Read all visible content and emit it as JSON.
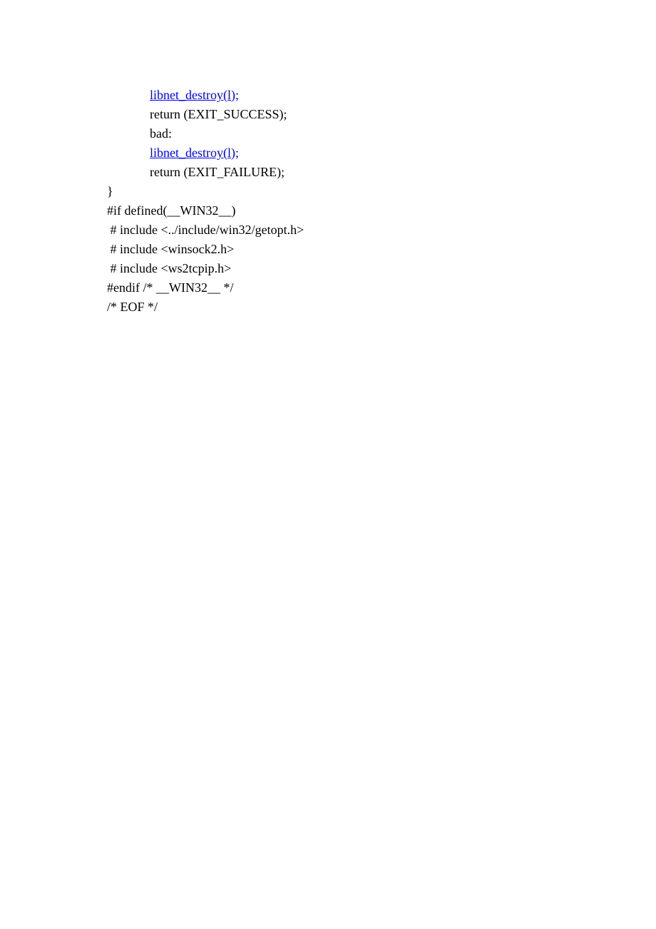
{
  "lines": [
    {
      "indent": true,
      "segments": [
        {
          "type": "link",
          "text": "libnet_destroy(l);"
        }
      ]
    },
    {
      "indent": true,
      "segments": [
        {
          "type": "text",
          "text": "return (EXIT_SUCCESS);"
        }
      ]
    },
    {
      "indent": true,
      "segments": [
        {
          "type": "text",
          "text": "bad:"
        }
      ]
    },
    {
      "indent": true,
      "segments": [
        {
          "type": "link",
          "text": "libnet_destroy(l);"
        }
      ]
    },
    {
      "indent": true,
      "segments": [
        {
          "type": "text",
          "text": "return (EXIT_FAILURE);"
        }
      ]
    },
    {
      "indent": false,
      "segments": [
        {
          "type": "text",
          "text": "}"
        }
      ]
    },
    {
      "indent": false,
      "segments": [
        {
          "type": "text",
          "text": "#if defined(__WIN32__)"
        }
      ]
    },
    {
      "indent": false,
      "segments": [
        {
          "type": "text",
          "text": " # include <../include/win32/getopt.h>"
        }
      ]
    },
    {
      "indent": false,
      "segments": [
        {
          "type": "text",
          "text": " # include <winsock2.h>"
        }
      ]
    },
    {
      "indent": false,
      "segments": [
        {
          "type": "text",
          "text": " # include <ws2tcpip.h>"
        }
      ]
    },
    {
      "indent": false,
      "segments": [
        {
          "type": "text",
          "text": "#endif /* __WIN32__ */"
        }
      ]
    },
    {
      "indent": false,
      "segments": [
        {
          "type": "text",
          "text": "/* EOF */"
        }
      ]
    }
  ]
}
